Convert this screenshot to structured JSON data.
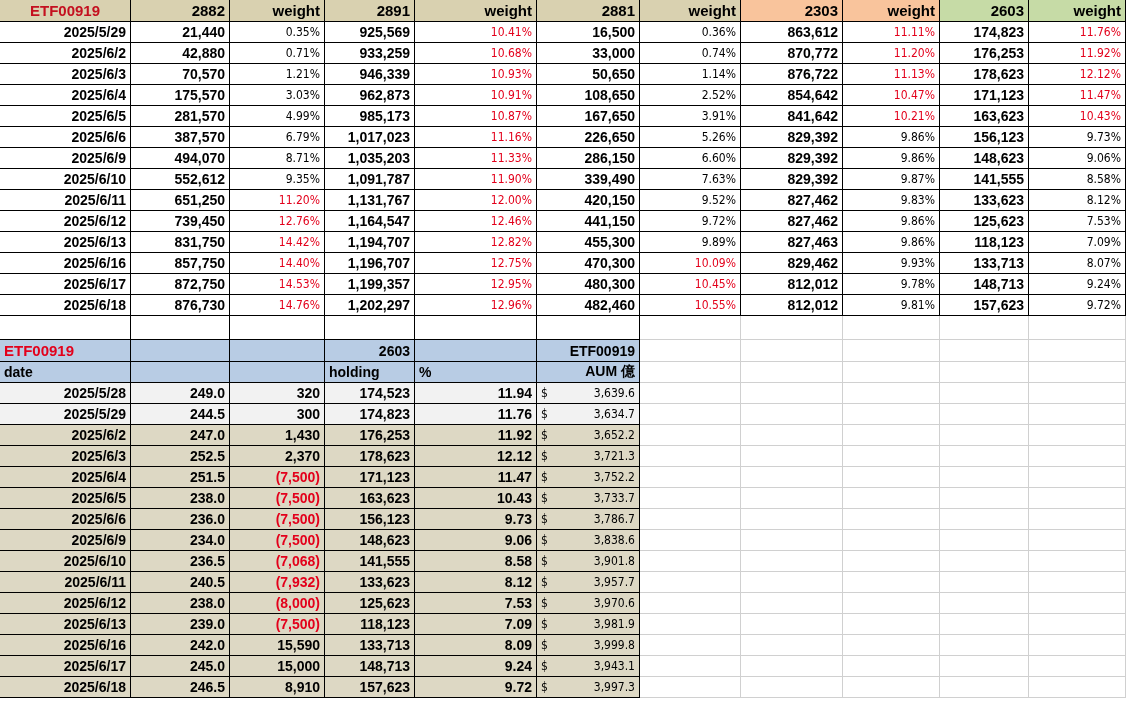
{
  "top_table": {
    "columns": [
      {
        "label": "ETF00919",
        "color": "#d9d1b0"
      },
      {
        "label": "2882",
        "color": "#d9d1b0"
      },
      {
        "label": "weight",
        "color": "#d9d1b0"
      },
      {
        "label": "2891",
        "color": "#d9d1b0"
      },
      {
        "label": "weight",
        "color": "#d9d1b0"
      },
      {
        "label": "2881",
        "color": "#d9d1b0"
      },
      {
        "label": "weight",
        "color": "#d9d1b0"
      },
      {
        "label": "2303",
        "color": "#f9c49c"
      },
      {
        "label": "weight",
        "color": "#f9c49c"
      },
      {
        "label": "2603",
        "color": "#c6dba6"
      },
      {
        "label": "weight",
        "color": "#c6dba6"
      }
    ],
    "rows": [
      {
        "date": "2025/5/29",
        "values": [
          {
            "shares": "21,440",
            "weight": "0.35%",
            "over": false
          },
          {
            "shares": "925,569",
            "weight": "10.41%",
            "over": true
          },
          {
            "shares": "16,500",
            "weight": "0.36%",
            "over": false
          },
          {
            "shares": "863,612",
            "weight": "11.11%",
            "over": true
          },
          {
            "shares": "174,823",
            "weight": "11.76%",
            "over": true
          }
        ]
      },
      {
        "date": "2025/6/2",
        "values": [
          {
            "shares": "42,880",
            "weight": "0.71%",
            "over": false
          },
          {
            "shares": "933,259",
            "weight": "10.68%",
            "over": true
          },
          {
            "shares": "33,000",
            "weight": "0.74%",
            "over": false
          },
          {
            "shares": "870,772",
            "weight": "11.20%",
            "over": true
          },
          {
            "shares": "176,253",
            "weight": "11.92%",
            "over": true
          }
        ]
      },
      {
        "date": "2025/6/3",
        "values": [
          {
            "shares": "70,570",
            "weight": "1.21%",
            "over": false
          },
          {
            "shares": "946,339",
            "weight": "10.93%",
            "over": true
          },
          {
            "shares": "50,650",
            "weight": "1.14%",
            "over": false
          },
          {
            "shares": "876,722",
            "weight": "11.13%",
            "over": true
          },
          {
            "shares": "178,623",
            "weight": "12.12%",
            "over": true
          }
        ]
      },
      {
        "date": "2025/6/4",
        "values": [
          {
            "shares": "175,570",
            "weight": "3.03%",
            "over": false
          },
          {
            "shares": "962,873",
            "weight": "10.91%",
            "over": true
          },
          {
            "shares": "108,650",
            "weight": "2.52%",
            "over": false
          },
          {
            "shares": "854,642",
            "weight": "10.47%",
            "over": true
          },
          {
            "shares": "171,123",
            "weight": "11.47%",
            "over": true
          }
        ]
      },
      {
        "date": "2025/6/5",
        "values": [
          {
            "shares": "281,570",
            "weight": "4.99%",
            "over": false
          },
          {
            "shares": "985,173",
            "weight": "10.87%",
            "over": true
          },
          {
            "shares": "167,650",
            "weight": "3.91%",
            "over": false
          },
          {
            "shares": "841,642",
            "weight": "10.21%",
            "over": true
          },
          {
            "shares": "163,623",
            "weight": "10.43%",
            "over": true
          }
        ]
      },
      {
        "date": "2025/6/6",
        "values": [
          {
            "shares": "387,570",
            "weight": "6.79%",
            "over": false
          },
          {
            "shares": "1,017,023",
            "weight": "11.16%",
            "over": true
          },
          {
            "shares": "226,650",
            "weight": "5.26%",
            "over": false
          },
          {
            "shares": "829,392",
            "weight": "9.86%",
            "over": false
          },
          {
            "shares": "156,123",
            "weight": "9.73%",
            "over": false
          }
        ]
      },
      {
        "date": "2025/6/9",
        "values": [
          {
            "shares": "494,070",
            "weight": "8.71%",
            "over": false
          },
          {
            "shares": "1,035,203",
            "weight": "11.33%",
            "over": true
          },
          {
            "shares": "286,150",
            "weight": "6.60%",
            "over": false
          },
          {
            "shares": "829,392",
            "weight": "9.86%",
            "over": false
          },
          {
            "shares": "148,623",
            "weight": "9.06%",
            "over": false
          }
        ]
      },
      {
        "date": "2025/6/10",
        "values": [
          {
            "shares": "552,612",
            "weight": "9.35%",
            "over": false
          },
          {
            "shares": "1,091,787",
            "weight": "11.90%",
            "over": true
          },
          {
            "shares": "339,490",
            "weight": "7.63%",
            "over": false
          },
          {
            "shares": "829,392",
            "weight": "9.87%",
            "over": false
          },
          {
            "shares": "141,555",
            "weight": "8.58%",
            "over": false
          }
        ]
      },
      {
        "date": "2025/6/11",
        "values": [
          {
            "shares": "651,250",
            "weight": "11.20%",
            "over": true
          },
          {
            "shares": "1,131,767",
            "weight": "12.00%",
            "over": true
          },
          {
            "shares": "420,150",
            "weight": "9.52%",
            "over": false
          },
          {
            "shares": "827,462",
            "weight": "9.83%",
            "over": false
          },
          {
            "shares": "133,623",
            "weight": "8.12%",
            "over": false
          }
        ]
      },
      {
        "date": "2025/6/12",
        "values": [
          {
            "shares": "739,450",
            "weight": "12.76%",
            "over": true
          },
          {
            "shares": "1,164,547",
            "weight": "12.46%",
            "over": true
          },
          {
            "shares": "441,150",
            "weight": "9.72%",
            "over": false
          },
          {
            "shares": "827,462",
            "weight": "9.86%",
            "over": false
          },
          {
            "shares": "125,623",
            "weight": "7.53%",
            "over": false
          }
        ]
      },
      {
        "date": "2025/6/13",
        "values": [
          {
            "shares": "831,750",
            "weight": "14.42%",
            "over": true
          },
          {
            "shares": "1,194,707",
            "weight": "12.82%",
            "over": true
          },
          {
            "shares": "455,300",
            "weight": "9.89%",
            "over": false
          },
          {
            "shares": "827,463",
            "weight": "9.86%",
            "over": false
          },
          {
            "shares": "118,123",
            "weight": "7.09%",
            "over": false
          }
        ]
      },
      {
        "date": "2025/6/16",
        "values": [
          {
            "shares": "857,750",
            "weight": "14.40%",
            "over": true
          },
          {
            "shares": "1,196,707",
            "weight": "12.75%",
            "over": true
          },
          {
            "shares": "470,300",
            "weight": "10.09%",
            "over": true
          },
          {
            "shares": "829,462",
            "weight": "9.93%",
            "over": false
          },
          {
            "shares": "133,713",
            "weight": "8.07%",
            "over": false
          }
        ]
      },
      {
        "date": "2025/6/17",
        "values": [
          {
            "shares": "872,750",
            "weight": "14.53%",
            "over": true
          },
          {
            "shares": "1,199,357",
            "weight": "12.95%",
            "over": true
          },
          {
            "shares": "480,300",
            "weight": "10.45%",
            "over": true
          },
          {
            "shares": "812,012",
            "weight": "9.78%",
            "over": false
          },
          {
            "shares": "148,713",
            "weight": "9.24%",
            "over": false
          }
        ]
      },
      {
        "date": "2025/6/18",
        "values": [
          {
            "shares": "876,730",
            "weight": "14.76%",
            "over": true
          },
          {
            "shares": "1,202,297",
            "weight": "12.96%",
            "over": true
          },
          {
            "shares": "482,460",
            "weight": "10.55%",
            "over": true
          },
          {
            "shares": "812,012",
            "weight": "9.81%",
            "over": false
          },
          {
            "shares": "157,623",
            "weight": "9.72%",
            "over": false
          }
        ]
      }
    ]
  },
  "bottom_table": {
    "group_header": {
      "fund": "ETF00919",
      "stock": "2603",
      "aum_fund": "ETF00919"
    },
    "column_header": {
      "date": "date",
      "holding": "holding",
      "percent": "%",
      "aum": "AUM 億"
    },
    "rows": [
      {
        "date": "2025/5/28",
        "price": "249.0",
        "change": "320",
        "negative": false,
        "holding": "174,523",
        "percent": "11.94",
        "currency": "$",
        "aum": "3,639.6",
        "shaded": false
      },
      {
        "date": "2025/5/29",
        "price": "244.5",
        "change": "300",
        "negative": false,
        "holding": "174,823",
        "percent": "11.76",
        "currency": "$",
        "aum": "3,634.7",
        "shaded": false
      },
      {
        "date": "2025/6/2",
        "price": "247.0",
        "change": "1,430",
        "negative": false,
        "holding": "176,253",
        "percent": "11.92",
        "currency": "$",
        "aum": "3,652.2",
        "shaded": true
      },
      {
        "date": "2025/6/3",
        "price": "252.5",
        "change": "2,370",
        "negative": false,
        "holding": "178,623",
        "percent": "12.12",
        "currency": "$",
        "aum": "3,721.3",
        "shaded": true
      },
      {
        "date": "2025/6/4",
        "price": "251.5",
        "change": "(7,500)",
        "negative": true,
        "holding": "171,123",
        "percent": "11.47",
        "currency": "$",
        "aum": "3,752.2",
        "shaded": true
      },
      {
        "date": "2025/6/5",
        "price": "238.0",
        "change": "(7,500)",
        "negative": true,
        "holding": "163,623",
        "percent": "10.43",
        "currency": "$",
        "aum": "3,733.7",
        "shaded": true
      },
      {
        "date": "2025/6/6",
        "price": "236.0",
        "change": "(7,500)",
        "negative": true,
        "holding": "156,123",
        "percent": "9.73",
        "currency": "$",
        "aum": "3,786.7",
        "shaded": true
      },
      {
        "date": "2025/6/9",
        "price": "234.0",
        "change": "(7,500)",
        "negative": true,
        "holding": "148,623",
        "percent": "9.06",
        "currency": "$",
        "aum": "3,838.6",
        "shaded": true
      },
      {
        "date": "2025/6/10",
        "price": "236.5",
        "change": "(7,068)",
        "negative": true,
        "holding": "141,555",
        "percent": "8.58",
        "currency": "$",
        "aum": "3,901.8",
        "shaded": true
      },
      {
        "date": "2025/6/11",
        "price": "240.5",
        "change": "(7,932)",
        "negative": true,
        "holding": "133,623",
        "percent": "8.12",
        "currency": "$",
        "aum": "3,957.7",
        "shaded": true
      },
      {
        "date": "2025/6/12",
        "price": "238.0",
        "change": "(8,000)",
        "negative": true,
        "holding": "125,623",
        "percent": "7.53",
        "currency": "$",
        "aum": "3,970.6",
        "shaded": true
      },
      {
        "date": "2025/6/13",
        "price": "239.0",
        "change": "(7,500)",
        "negative": true,
        "holding": "118,123",
        "percent": "7.09",
        "currency": "$",
        "aum": "3,981.9",
        "shaded": true
      },
      {
        "date": "2025/6/16",
        "price": "242.0",
        "change": "15,590",
        "negative": false,
        "holding": "133,713",
        "percent": "8.09",
        "currency": "$",
        "aum": "3,999.8",
        "shaded": true
      },
      {
        "date": "2025/6/17",
        "price": "245.0",
        "change": "15,000",
        "negative": false,
        "holding": "148,713",
        "percent": "9.24",
        "currency": "$",
        "aum": "3,943.1",
        "shaded": true
      },
      {
        "date": "2025/6/18",
        "price": "246.5",
        "change": "8,910",
        "negative": false,
        "holding": "157,623",
        "percent": "9.72",
        "currency": "$",
        "aum": "3,997.3",
        "shaded": true
      }
    ]
  }
}
